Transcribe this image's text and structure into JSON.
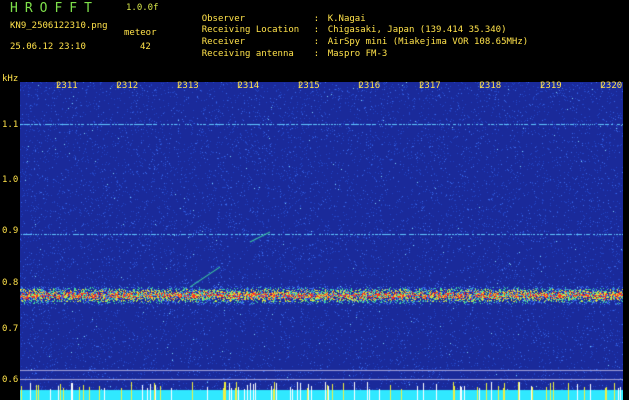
{
  "header": {
    "app_title": "HROFFT",
    "version": "1.0.0f",
    "filename": "KN9_2506122310.png",
    "meteor_label": "meteor",
    "datetime": "25.06.12 23:10",
    "meteor_count": "42",
    "info": [
      {
        "label": "Observer",
        "value": "K.Nagai"
      },
      {
        "label": "Receiving Location",
        "value": "Chigasaki, Japan (139.414 35.340)"
      },
      {
        "label": "Receiver",
        "value": "AirSpy mini (Miakejima VOR 108.65MHz)"
      },
      {
        "label": "Receiving antenna",
        "value": "Maspro FM-3"
      }
    ]
  },
  "spectrogram": {
    "y_unit": "kHz",
    "y_ticks": [
      "1.1",
      "1.0",
      "0.9",
      "0.8",
      "0.7",
      "0.6"
    ],
    "time_ticks": [
      "2311",
      "2312",
      "2313",
      "2314",
      "2315",
      "2316",
      "2317",
      "2318",
      "2319",
      "2320"
    ],
    "colors": {
      "background": "#1a2a9a",
      "noise": "#3a6cf0",
      "band": "#e0e040",
      "peak": "#ff3020",
      "baseline": "#30e8ff"
    }
  }
}
